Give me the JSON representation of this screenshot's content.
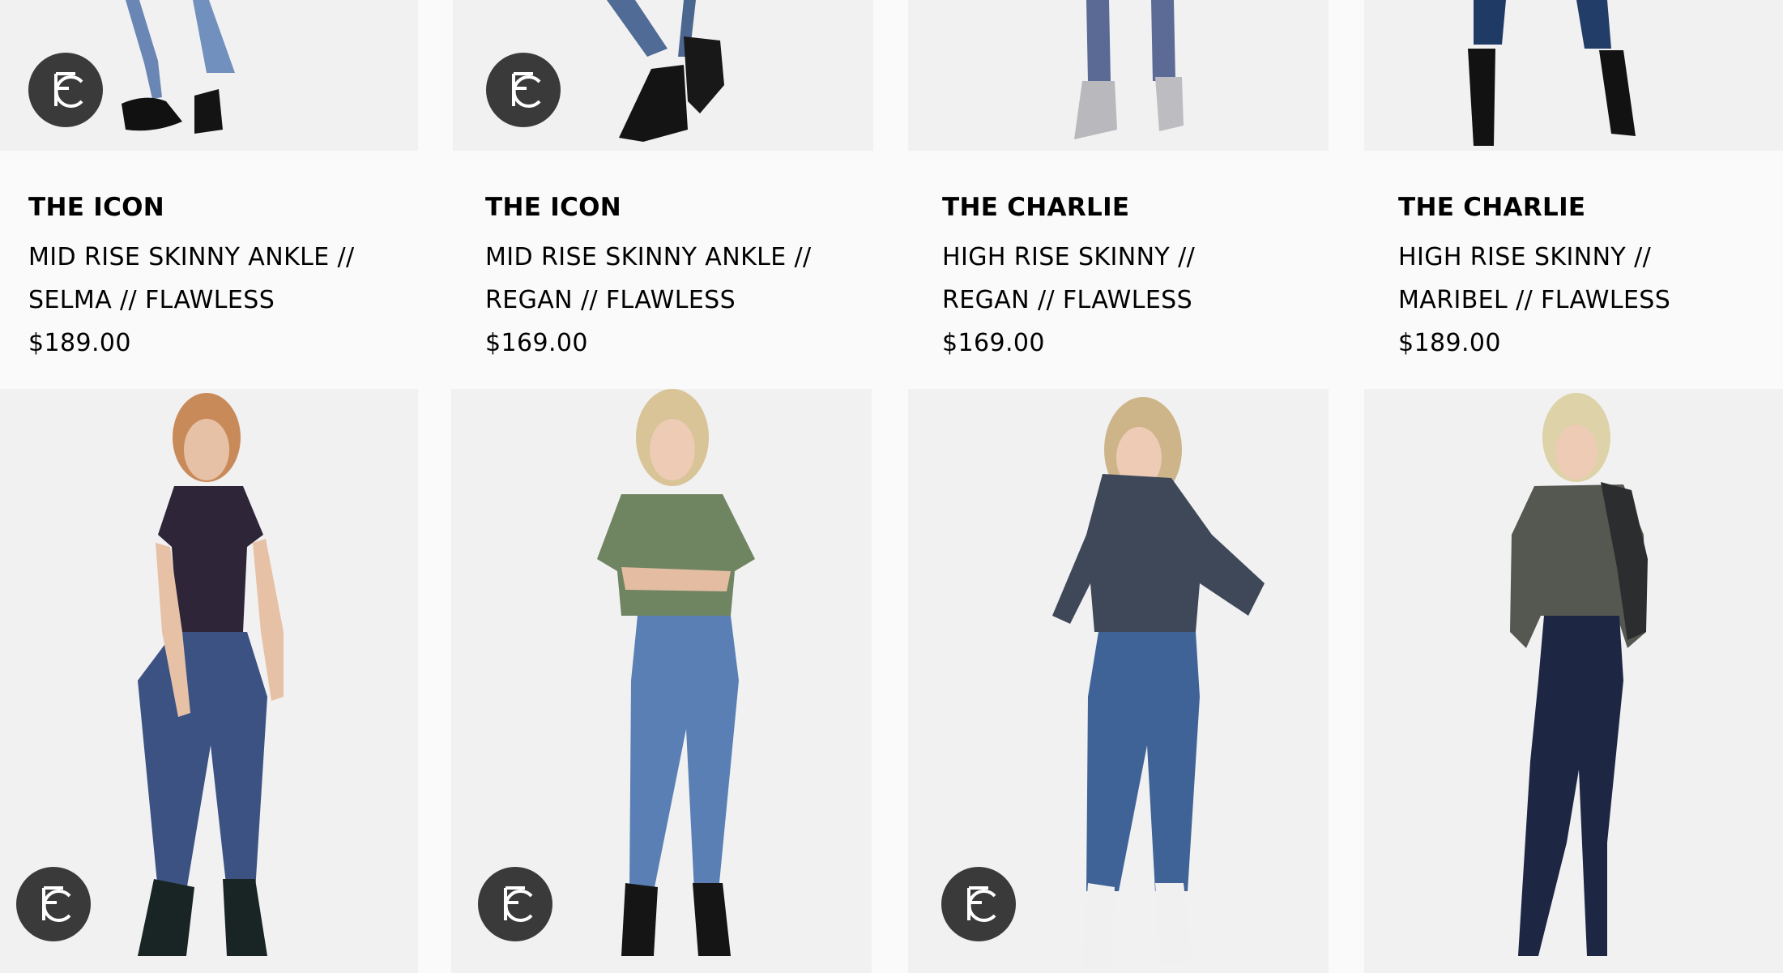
{
  "products_top": [
    {
      "name": "THE ICON",
      "line1": "MID RISE SKINNY ANKLE //",
      "line2": "SELMA // FLAWLESS",
      "price": "$189.00"
    },
    {
      "name": "THE ICON",
      "line1": "MID RISE SKINNY ANKLE //",
      "line2": "REGAN // FLAWLESS",
      "price": "$169.00"
    },
    {
      "name": "THE CHARLIE",
      "line1": "HIGH RISE SKINNY //",
      "line2": "REGAN // FLAWLESS",
      "price": "$169.00"
    },
    {
      "name": "THE CHARLIE",
      "line1": "HIGH RISE SKINNY //",
      "line2": "MARIBEL // FLAWLESS",
      "price": "$189.00"
    }
  ],
  "badge": {
    "icon": "fc-logo-badge-icon",
    "color": "#3a3a3a"
  },
  "colors": {
    "background": "#fafafa",
    "image_bg": "#f1f1f1",
    "text": "#000000"
  }
}
